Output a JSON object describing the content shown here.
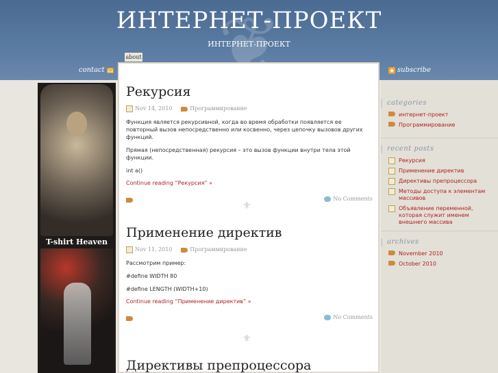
{
  "header": {
    "site_title": "ИНТЕРНЕТ-ПРОЕКТ",
    "site_description": "ИНТЕРНЕТ-ПРОЕКТ",
    "tab_about": "about",
    "contact": "contact",
    "subscribe": "subscribe"
  },
  "ad": {
    "label": "T-shirt Heaven"
  },
  "posts": [
    {
      "title": "Рекурсия",
      "date": "Nov 14, 2010",
      "category": "Программирование",
      "paragraphs": [
        "Функция является рекурсивной, когда во время обработки появляется ее повторный вызов непосредственно или косвенно, через цепочку вызовов других функций.",
        "Прямая (непосредственная) рекурсия – это вызов функции внутри тела этой функции.",
        "int a()"
      ],
      "more": "Continue reading “Рекурсия” »",
      "comments": "No Comments"
    },
    {
      "title": "Применение директив",
      "date": "Nov 11, 2010",
      "category": "Программирование",
      "paragraphs": [
        "Рассмотрим пример:",
        "#define WIDTH 80",
        "#define LENGTH (WIDTH+10)"
      ],
      "more": "Continue reading “Применение директив” »",
      "comments": "No Comments"
    },
    {
      "title": "Директивы препроцессора"
    }
  ],
  "sidebar": {
    "categories": {
      "title": "categories",
      "items": [
        "интернет-проект",
        "Программирование"
      ]
    },
    "recent_posts": {
      "title": "recent posts",
      "items": [
        "Рекурсия",
        "Применение директив",
        "Директивы препроцессора",
        "Методы доступа к элементам массивов",
        "Объявление переменной, которая служит именем внешнего массива"
      ]
    },
    "archives": {
      "title": "archives",
      "items": [
        "November 2010",
        "October 2010"
      ]
    }
  },
  "colors": {
    "header_blue": "#5a7ba2",
    "link_red": "#b02020",
    "sidebar_title": "#8a93a8"
  }
}
